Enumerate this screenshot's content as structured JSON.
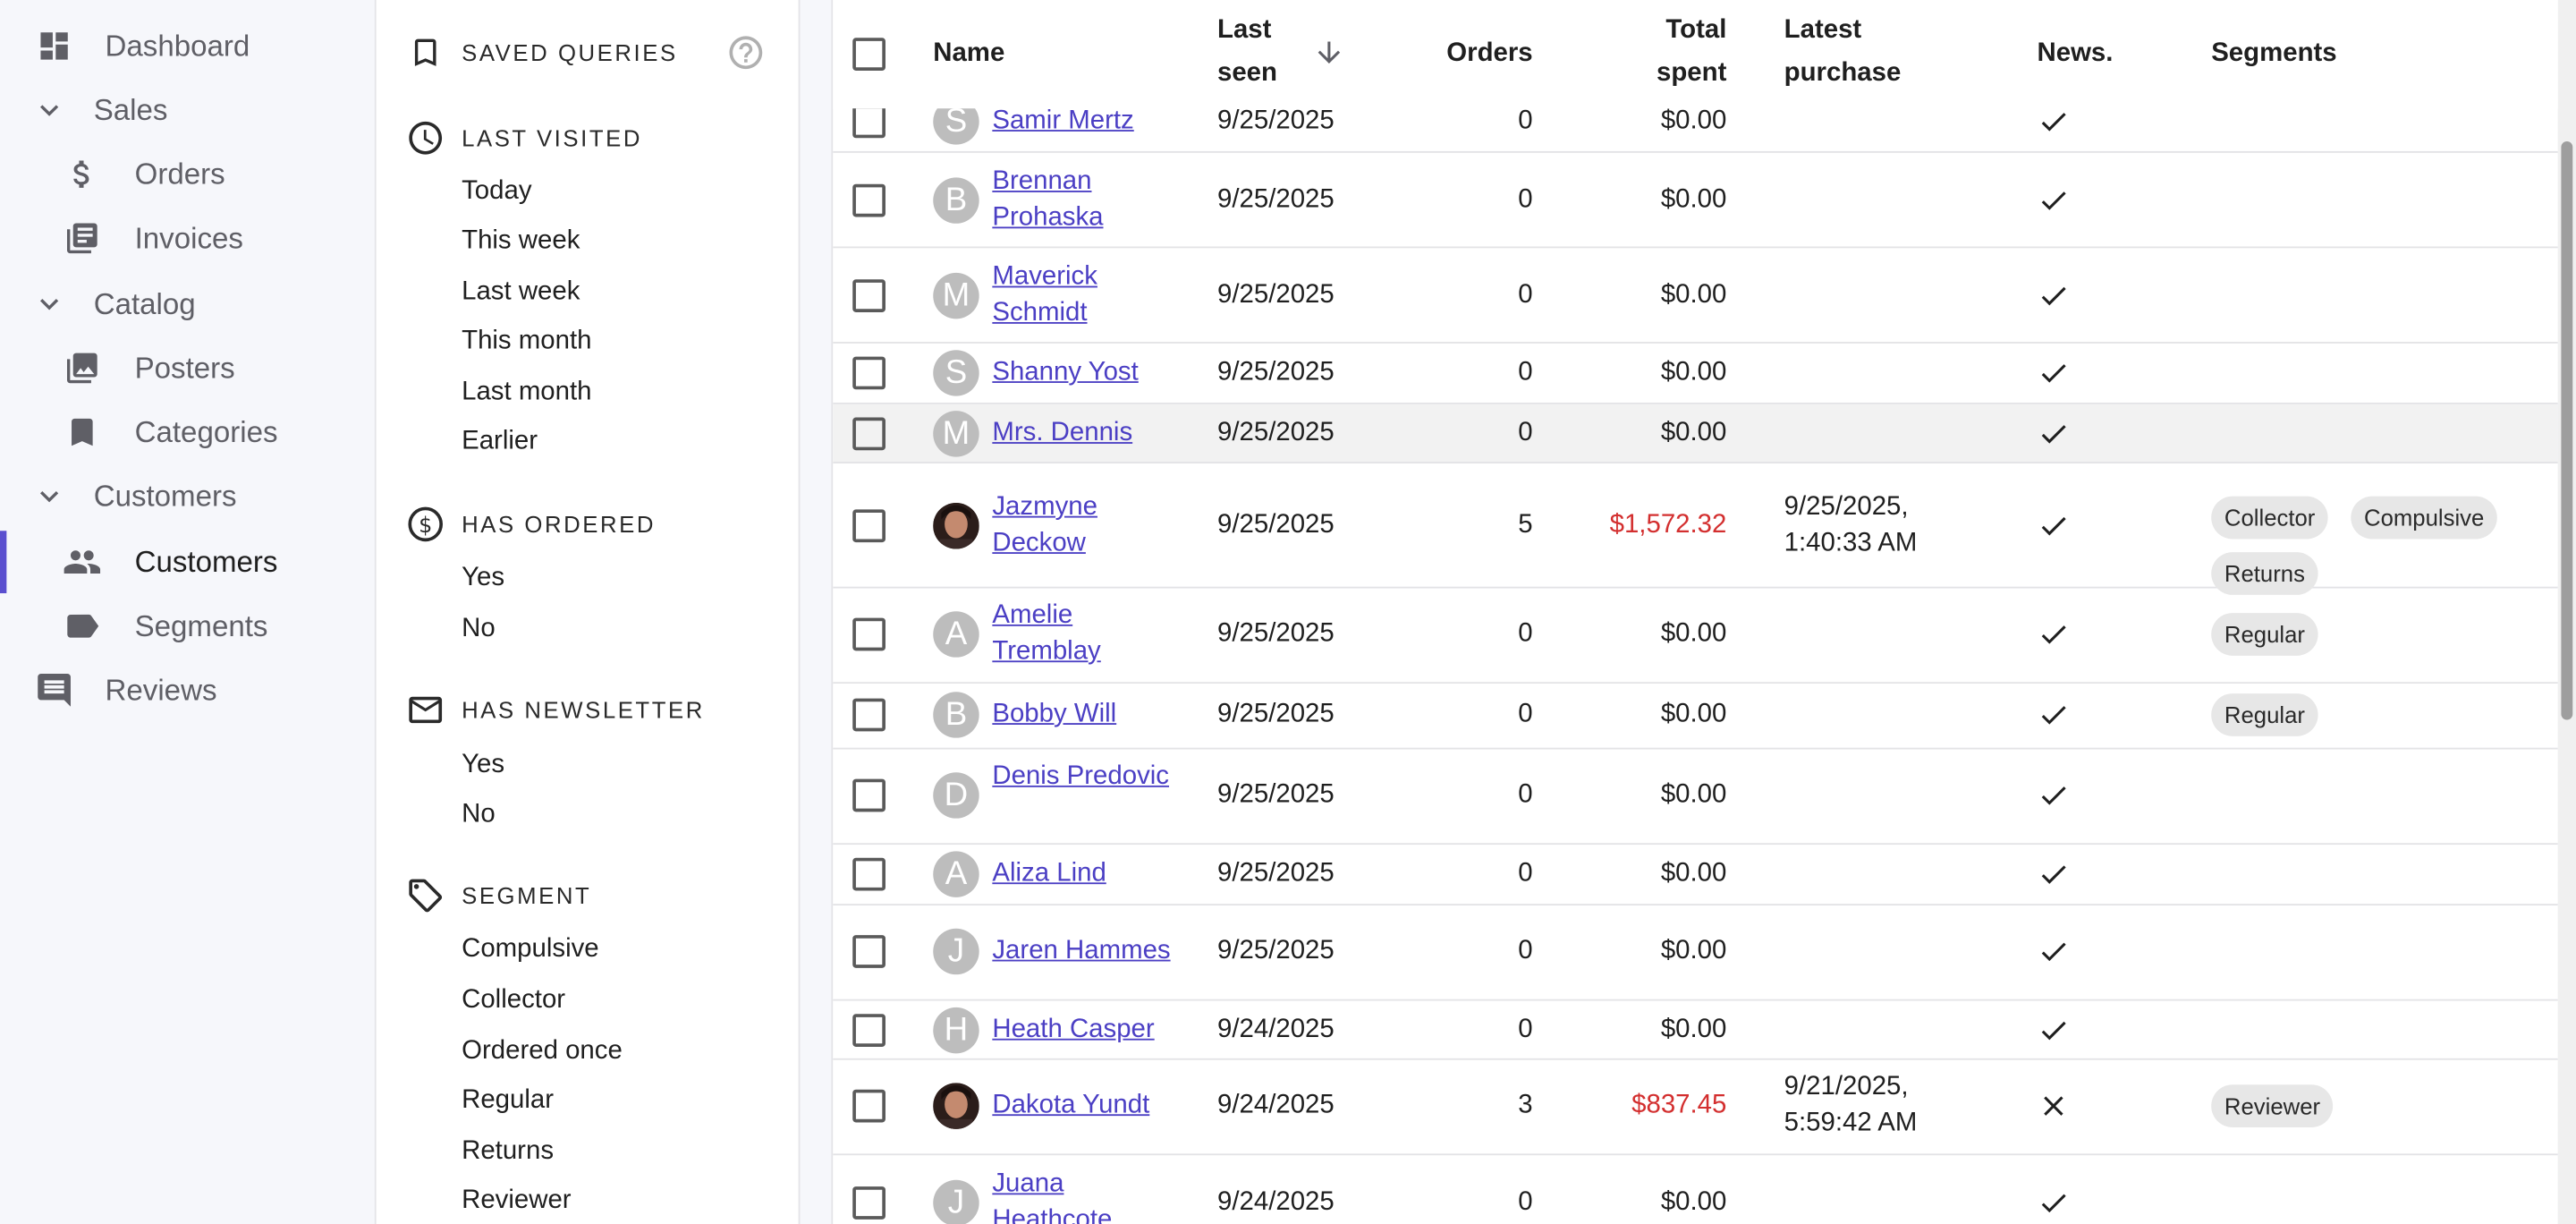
{
  "nav": {
    "items": [
      {
        "label": "Dashboard",
        "icon": "dashboard-icon"
      },
      {
        "label": "Sales",
        "icon": "chevron-down-icon"
      },
      {
        "label": "Orders",
        "icon": "dollar-icon"
      },
      {
        "label": "Invoices",
        "icon": "invoices-icon"
      },
      {
        "label": "Catalog",
        "icon": "chevron-down-icon"
      },
      {
        "label": "Posters",
        "icon": "image-icon"
      },
      {
        "label": "Categories",
        "icon": "bookmark-icon"
      },
      {
        "label": "Customers",
        "icon": "chevron-down-icon"
      },
      {
        "label": "Customers",
        "icon": "people-icon"
      },
      {
        "label": "Segments",
        "icon": "label-icon"
      },
      {
        "label": "Reviews",
        "icon": "comment-icon"
      }
    ],
    "active": "Customers"
  },
  "filters": {
    "saved_queries": "SAVED QUERIES",
    "last_visited": {
      "title": "LAST VISITED",
      "options": [
        "Today",
        "This week",
        "Last week",
        "This month",
        "Last month",
        "Earlier"
      ]
    },
    "has_ordered": {
      "title": "HAS ORDERED",
      "options": [
        "Yes",
        "No"
      ]
    },
    "has_newsletter": {
      "title": "HAS NEWSLETTER",
      "options": [
        "Yes",
        "No"
      ]
    },
    "segment": {
      "title": "SEGMENT",
      "options": [
        "Compulsive",
        "Collector",
        "Ordered once",
        "Regular",
        "Returns",
        "Reviewer"
      ]
    }
  },
  "table": {
    "headers": {
      "name": "Name",
      "last_seen_1": "Last",
      "last_seen_2": "seen",
      "orders": "Orders",
      "total_1": "Total",
      "total_2": "spent",
      "latest_1": "Latest",
      "latest_2": "purchase",
      "news": "News.",
      "segments": "Segments"
    },
    "rows": [
      {
        "initial": "S",
        "name": "Samir Mertz",
        "last_seen": "9/25/2025",
        "orders": "0",
        "total": "$0.00",
        "latest": "",
        "news": true,
        "segments": []
      },
      {
        "initial": "B",
        "name": "Brennan Prohaska",
        "last_seen": "9/25/2025",
        "orders": "0",
        "total": "$0.00",
        "latest": "",
        "news": true,
        "segments": []
      },
      {
        "initial": "M",
        "name": "Maverick Schmidt",
        "last_seen": "9/25/2025",
        "orders": "0",
        "total": "$0.00",
        "latest": "",
        "news": true,
        "segments": []
      },
      {
        "initial": "S",
        "name": "Shanny Yost",
        "last_seen": "9/25/2025",
        "orders": "0",
        "total": "$0.00",
        "latest": "",
        "news": true,
        "segments": []
      },
      {
        "initial": "M",
        "name": "Mrs. Dennis",
        "last_seen": "9/25/2025",
        "orders": "0",
        "total": "$0.00",
        "latest": "",
        "news": true,
        "segments": []
      },
      {
        "initial": "",
        "photo": true,
        "name": "Jazmyne Deckow",
        "last_seen": "9/25/2025",
        "orders": "5",
        "total": "$1,572.32",
        "latest": "9/25/2025, 1:40:33 AM",
        "news": true,
        "segments": [
          "Collector",
          "Compulsive",
          "Returns"
        ]
      },
      {
        "initial": "A",
        "name": "Amelie Tremblay",
        "last_seen": "9/25/2025",
        "orders": "0",
        "total": "$0.00",
        "latest": "",
        "news": true,
        "segments": [
          "Regular"
        ]
      },
      {
        "initial": "B",
        "name": "Bobby Will",
        "last_seen": "9/25/2025",
        "orders": "0",
        "total": "$0.00",
        "latest": "",
        "news": true,
        "segments": [
          "Regular"
        ]
      },
      {
        "initial": "D",
        "name": "Denis Predovic",
        "last_seen": "9/25/2025",
        "orders": "0",
        "total": "$0.00",
        "latest": "",
        "news": true,
        "segments": []
      },
      {
        "initial": "A",
        "name": "Aliza Lind",
        "last_seen": "9/25/2025",
        "orders": "0",
        "total": "$0.00",
        "latest": "",
        "news": true,
        "segments": []
      },
      {
        "initial": "J",
        "name": "Jaren Hammes",
        "last_seen": "9/25/2025",
        "orders": "0",
        "total": "$0.00",
        "latest": "",
        "news": true,
        "segments": []
      },
      {
        "initial": "H",
        "name": "Heath Casper",
        "last_seen": "9/24/2025",
        "orders": "0",
        "total": "$0.00",
        "latest": "",
        "news": true,
        "segments": []
      },
      {
        "initial": "",
        "photo": true,
        "name": "Dakota Yundt",
        "last_seen": "9/24/2025",
        "orders": "3",
        "total": "$837.45",
        "latest": "9/21/2025, 5:59:42 AM",
        "news": false,
        "segments": [
          "Reviewer"
        ]
      },
      {
        "initial": "J",
        "name": "Juana Heathcote",
        "last_seen": "9/24/2025",
        "orders": "0",
        "total": "$0.00",
        "latest": "",
        "news": true,
        "segments": []
      }
    ]
  },
  "colors": {
    "accent": "#5a4fcf",
    "link": "#4b3fc4",
    "money_red": "#d32f2f"
  }
}
